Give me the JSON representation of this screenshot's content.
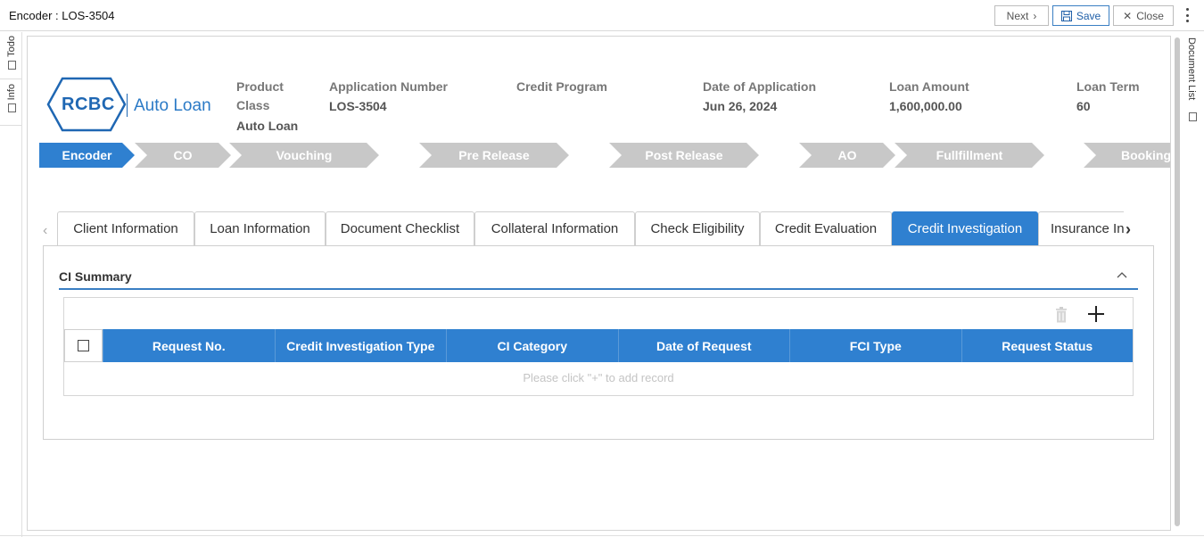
{
  "window": {
    "title": "Encoder : LOS-3504",
    "next_label": "Next",
    "save_label": "Save",
    "close_label": "Close"
  },
  "left_rail": {
    "todo": "Todo",
    "info": "Info"
  },
  "right_rail": {
    "document_list": "Document List"
  },
  "logo": {
    "brand": "RCBC",
    "product": "Auto Loan"
  },
  "header": {
    "product_class_label_1": "Product",
    "product_class_label_2": "Class",
    "product_class_value": "Auto Loan",
    "application_number_label": "Application Number",
    "application_number_value": "LOS-3504",
    "credit_program_label": "Credit Program",
    "date_of_application_label": "Date of Application",
    "date_of_application_value": "Jun 26, 2024",
    "loan_amount_label": "Loan Amount",
    "loan_amount_value": "1,600,000.00",
    "loan_term_label": "Loan Term",
    "loan_term_value": "60"
  },
  "stages": [
    "Encoder",
    "CO",
    "Vouching",
    "Pre Release",
    "Post Release",
    "AO",
    "Fullfillment",
    "Booking"
  ],
  "active_stage": "Encoder",
  "tabs": [
    "Client Information",
    "Loan Information",
    "Document Checklist",
    "Collateral Information",
    "Check Eligibility",
    "Credit Evaluation",
    "Credit Investigation",
    "Insurance In"
  ],
  "active_tab": "Credit Investigation",
  "section": {
    "title": "CI Summary"
  },
  "grid": {
    "columns": [
      "Request No.",
      "Credit Investigation Type",
      "CI Category",
      "Date of Request",
      "FCI Type",
      "Request Status"
    ],
    "empty_message": "Please click \"+\" to add record"
  },
  "colors": {
    "accent": "#2f80d0",
    "stage_inactive": "#c8c8c8",
    "brand": "#1f67b3"
  }
}
